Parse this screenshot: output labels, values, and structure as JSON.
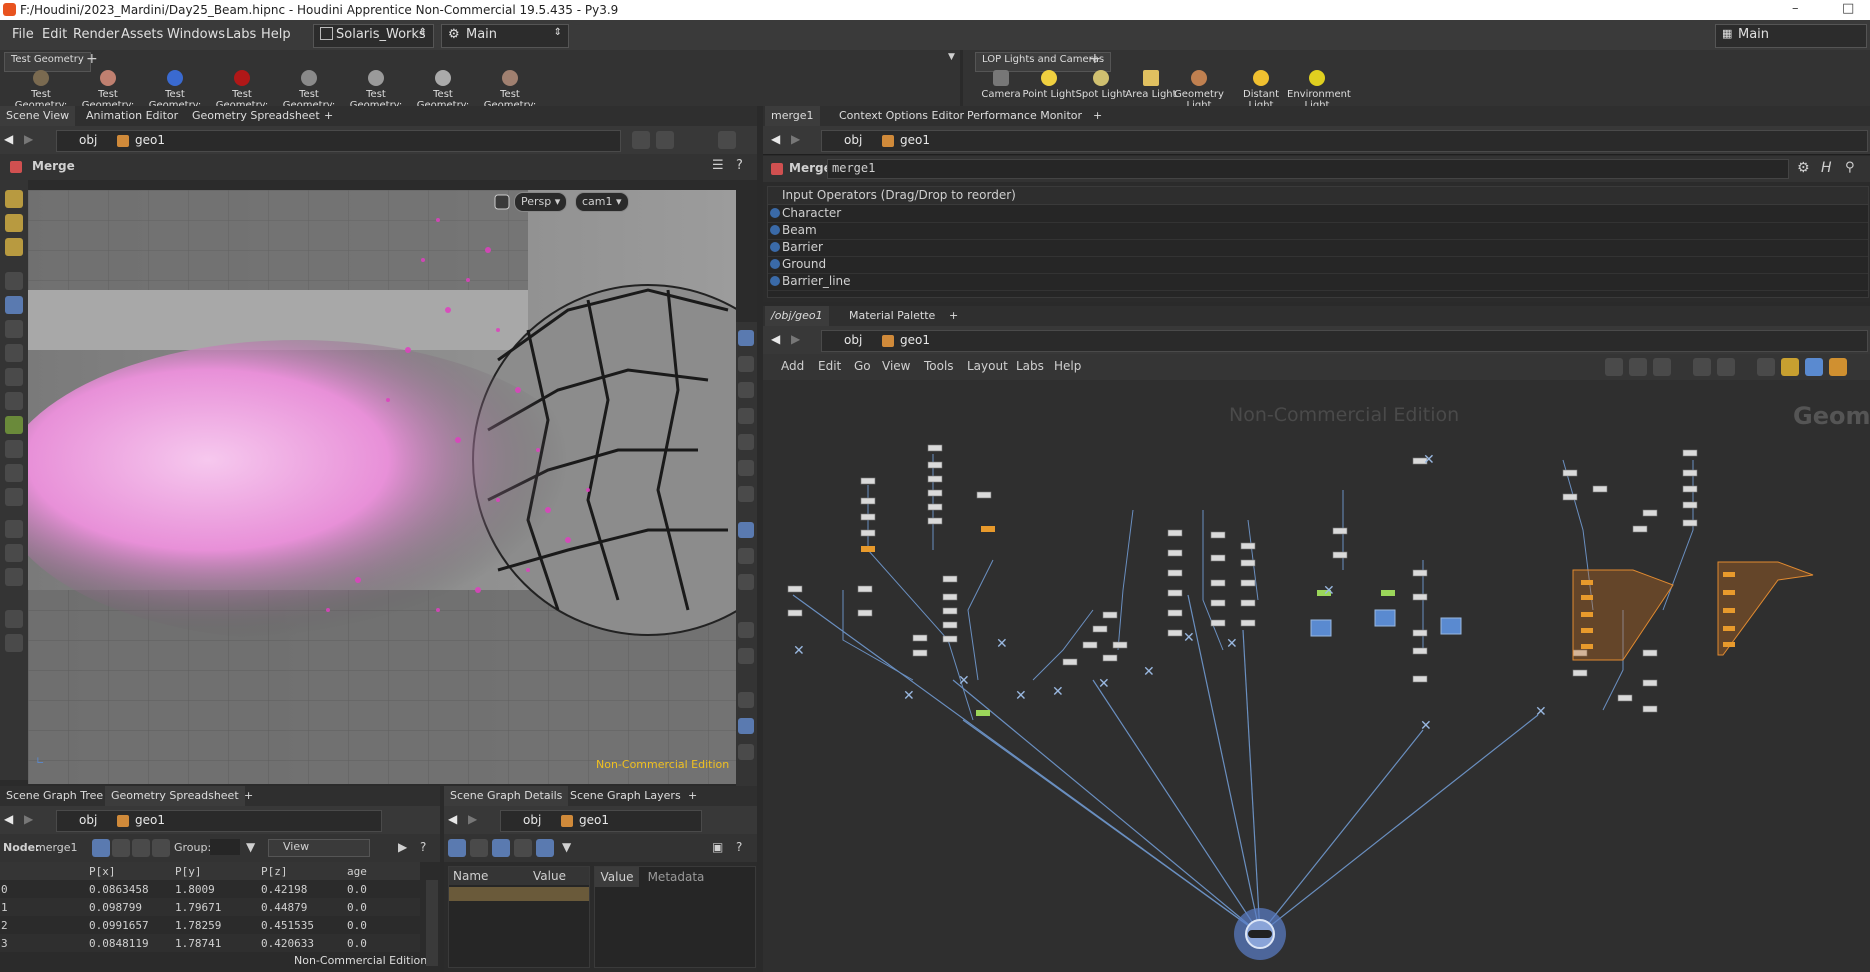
{
  "window": {
    "title": "F:/Houdini/2023_Mardini/Day25_Beam.hipnc - Houdini Apprentice Non-Commercial 19.5.435 - Py3.9"
  },
  "menu": {
    "items": [
      "File",
      "Edit",
      "Render",
      "Assets",
      "Windows",
      "Labs",
      "Help"
    ],
    "desktop": "Solaris_Works",
    "network_context": "Main",
    "right_label": "Main"
  },
  "shelf_left": {
    "tab": "Test Geometry",
    "tools": [
      "Test Geometry: C...",
      "Test Geometry: P...",
      "Test Geometry: R...",
      "Test Geometry: S...",
      "Test Geometry: S...",
      "Test Geometry: T...",
      "Test Geometry: T...",
      "Test Geometry: T..."
    ]
  },
  "shelf_right": {
    "tab": "LOP Lights and Cameras",
    "tools": [
      "Camera",
      "Point Light",
      "Spot Light",
      "Area Light",
      "Geometry Light",
      "Distant Light",
      "Environment Light"
    ]
  },
  "scene_view": {
    "tabs": [
      "Scene View",
      "Animation Editor",
      "Geometry Spreadsheet"
    ],
    "path": [
      "obj",
      "geo1"
    ],
    "operator": "Merge",
    "persp": "Persp",
    "camera": "cam1",
    "watermark": "Non-Commercial Edition"
  },
  "params": {
    "tabs": [
      "merge1",
      "Context Options Editor",
      "Performance Monitor"
    ],
    "path": [
      "obj",
      "geo1"
    ],
    "op_type": "Merge",
    "op_name": "merge1",
    "inputs_header": "Input Operators (Drag/Drop to reorder)",
    "inputs": [
      "Character",
      "Beam",
      "Barrier",
      "Ground",
      "Barrier_line"
    ]
  },
  "network": {
    "tabs": [
      "/obj/geo1",
      "Material Palette"
    ],
    "path": [
      "obj",
      "geo1"
    ],
    "menu": [
      "Add",
      "Edit",
      "Go",
      "View",
      "Tools",
      "Layout",
      "Labs",
      "Help"
    ],
    "watermark": "Non-Commercial Edition",
    "context_label": "Geome"
  },
  "spreadsheet": {
    "tabs": [
      "Scene Graph Tree",
      "Geometry Spreadsheet"
    ],
    "path": [
      "obj",
      "geo1"
    ],
    "node_label": "Node:",
    "node": "merge1",
    "group_label": "Group:",
    "view_label": "View",
    "columns": [
      "",
      "P[x]",
      "P[y]",
      "P[z]",
      "age"
    ],
    "rows": [
      [
        "0",
        "0.0863458",
        "1.8009",
        "0.42198",
        "0.0"
      ],
      [
        "1",
        "0.098799",
        "1.79671",
        "0.44879",
        "0.0"
      ],
      [
        "2",
        "0.0991657",
        "1.78259",
        "0.451535",
        "0.0"
      ],
      [
        "3",
        "0.0848119",
        "1.78741",
        "0.420633",
        "0.0"
      ]
    ],
    "watermark": "Non-Commercial Edition"
  },
  "sg_details": {
    "tabs": [
      "Scene Graph Details",
      "Scene Graph Layers"
    ],
    "path": [
      "obj",
      "geo1"
    ],
    "col_name": "Name",
    "col_value": "Value",
    "tab_value": "Value",
    "tab_metadata": "Metadata"
  },
  "colors": {
    "accent": "#e89a2c",
    "particle": "#e040c0",
    "node_blue": "#5a8fd8"
  }
}
